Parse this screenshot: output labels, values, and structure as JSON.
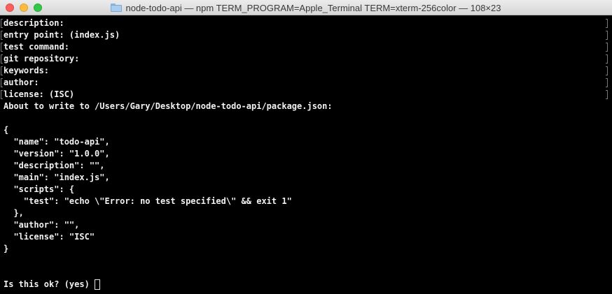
{
  "window": {
    "title": "node-todo-api — npm TERM_PROGRAM=Apple_Terminal TERM=xterm-256color — 108×23",
    "icon": "folder-icon"
  },
  "terminal": {
    "lines": [
      "description:",
      "entry point: (index.js)",
      "test command:",
      "git repository:",
      "keywords:",
      "author:",
      "license: (ISC)",
      "About to write to /Users/Gary/Desktop/node-todo-api/package.json:",
      "",
      "{",
      "  \"name\": \"todo-api\",",
      "  \"version\": \"1.0.0\",",
      "  \"description\": \"\",",
      "  \"main\": \"index.js\",",
      "  \"scripts\": {",
      "    \"test\": \"echo \\\"Error: no test specified\\\" && exit 1\"",
      "  },",
      "  \"author\": \"\",",
      "  \"license\": \"ISC\"",
      "}",
      "",
      ""
    ],
    "prompt": "Is this ok? (yes)"
  },
  "colors": {
    "background": "#000000",
    "text": "#f2f2f2",
    "close": "#fc605c",
    "minimize": "#fdbc40",
    "maximize": "#34c84a"
  }
}
